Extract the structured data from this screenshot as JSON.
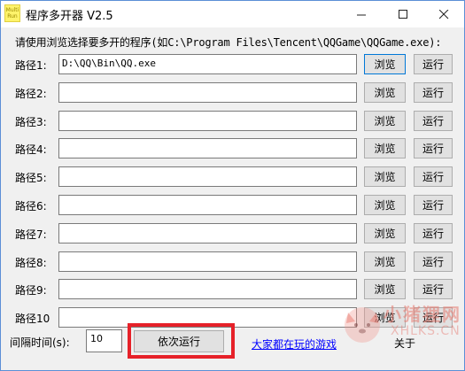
{
  "window": {
    "title": "程序多开器 V2.5",
    "icon_text": "Multi Run"
  },
  "instruction": "请使用浏览选择要多开的程序(如C:\\Program Files\\Tencent\\QQGame\\QQGame.exe):",
  "rows": [
    {
      "label": "路径1:",
      "value": "D:\\QQ\\Bin\\QQ.exe",
      "browse": "浏览",
      "run": "运行"
    },
    {
      "label": "路径2:",
      "value": "",
      "browse": "浏览",
      "run": "运行"
    },
    {
      "label": "路径3:",
      "value": "",
      "browse": "浏览",
      "run": "运行"
    },
    {
      "label": "路径4:",
      "value": "",
      "browse": "浏览",
      "run": "运行"
    },
    {
      "label": "路径5:",
      "value": "",
      "browse": "浏览",
      "run": "运行"
    },
    {
      "label": "路径6:",
      "value": "",
      "browse": "浏览",
      "run": "运行"
    },
    {
      "label": "路径7:",
      "value": "",
      "browse": "浏览",
      "run": "运行"
    },
    {
      "label": "路径8:",
      "value": "",
      "browse": "浏览",
      "run": "运行"
    },
    {
      "label": "路径9:",
      "value": "",
      "browse": "浏览",
      "run": "运行"
    },
    {
      "label": "路径10",
      "value": "",
      "browse": "浏览",
      "run": "运行"
    }
  ],
  "footer": {
    "interval_label": "间隔时间(s):",
    "interval_value": "10",
    "sequential_run": "依次运行",
    "games_link": "大家都在玩的游戏",
    "about": "关于"
  },
  "watermark": {
    "line1": "小猪狸网",
    "line2": "XHLKS.CN"
  },
  "colors": {
    "highlight": "#e62129",
    "link": "#0000ff",
    "focus_border": "#0078d7"
  }
}
